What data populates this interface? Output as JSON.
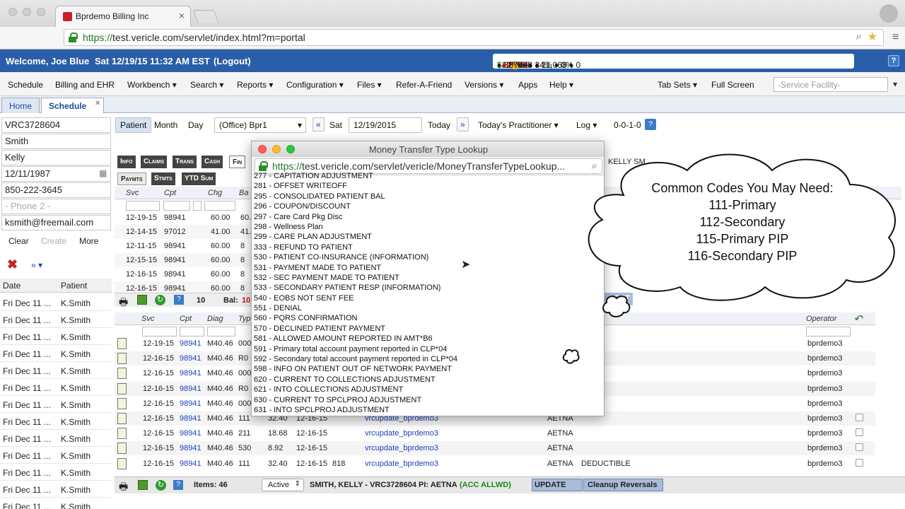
{
  "browser": {
    "tab_title": "Bprdemo Billing Inc",
    "url_secure": "https://",
    "url_rest": "test.vericle.com/servlet/index.html?m=portal"
  },
  "header": {
    "welcome": "Welcome, Joe Blue",
    "datetime": "Sat 12/19/15 11:32 AM EST",
    "logout": "(Logout)",
    "stats": {
      "s1": "$22,739",
      "s2": "♦ 32,399",
      "s3": "449",
      "s4": "♦ 1,030",
      "s5": "♦ 1,496",
      "s6": "27,448 ♦ 11,068 ♦ 0",
      "s7": "85% ♦ 34% ♦ 0%",
      "s8": "0%"
    },
    "help": "?"
  },
  "menu": {
    "items": [
      "Schedule",
      "Billing and EHR",
      "Workbench ▾",
      "Search ▾",
      "Reports ▾",
      "Configuration ▾",
      "Files ▾",
      "Refer-A-Friend",
      "Versions ▾",
      "Apps",
      "Help ▾"
    ],
    "tab_sets": "Tab Sets ▾",
    "full_screen": "Full Screen",
    "service_facility": "-Service Facility-"
  },
  "app_tabs": {
    "home": "Home",
    "schedule": "Schedule"
  },
  "patient": {
    "id": "VRC3728604",
    "last": "Smith",
    "first": "Kelly",
    "dob": "12/11/1987",
    "phone1": "850-222-3645",
    "phone2_placeholder": "- Phone 2 -",
    "email": "ksmith@freemail.com",
    "clear": "Clear",
    "create": "Create",
    "more": "More"
  },
  "list": {
    "date_header": "Date",
    "patient_header": "Patient",
    "rows": [
      {
        "date": "Fri Dec 11 ...",
        "patient": "K.Smith"
      },
      {
        "date": "Fri Dec 11 ...",
        "patient": "K.Smith"
      },
      {
        "date": "Fri Dec 11 ...",
        "patient": "K.Smith"
      },
      {
        "date": "Fri Dec 11 ...",
        "patient": "K.Smith"
      },
      {
        "date": "Fri Dec 11 ...",
        "patient": "K.Smith"
      },
      {
        "date": "Fri Dec 11 ...",
        "patient": "K.Smith"
      },
      {
        "date": "Fri Dec 11 ...",
        "patient": "K.Smith"
      },
      {
        "date": "Fri Dec 11 ...",
        "patient": "K.Smith"
      },
      {
        "date": "Fri Dec 11 ...",
        "patient": "K.Smith"
      },
      {
        "date": "Fri Dec 11 ...",
        "patient": "K.Smith"
      },
      {
        "date": "Fri Dec 11 ...",
        "patient": "K.Smith"
      },
      {
        "date": "Fri Dec 11 ...",
        "patient": "K.Smith"
      },
      {
        "date": "Fri Dec 11 ...",
        "patient": "K.Smith"
      }
    ]
  },
  "toolbar": {
    "patient": "Patient",
    "month": "Month",
    "day": "Day",
    "office": "(Office) Bpr1",
    "sat": "Sat",
    "date": "12/19/2015",
    "today": "Today",
    "practitioner": "Today's Practitioner ▾",
    "log": "Log ▾",
    "counter": "0-0-1-0",
    "patient_name_right": "KELLY SM"
  },
  "detail_tabs": [
    "Info",
    "Claims",
    "Trans",
    "Cash",
    "Fin"
  ],
  "sub_tabs": [
    "Paymts",
    "Stmts",
    "YTD Sum"
  ],
  "upper_grid": {
    "headers": [
      "Svc",
      "Cpt",
      "Chg",
      "Ba"
    ],
    "rows": [
      [
        "12-19-15",
        "98941",
        "60.00",
        "60."
      ],
      [
        "12-14-15",
        "97012",
        "41.00",
        "41."
      ],
      [
        "12-11-15",
        "98941",
        "60.00",
        "8"
      ],
      [
        "12-15-15",
        "98941",
        "60.00",
        "8"
      ],
      [
        "12-16-15",
        "98941",
        "60.00",
        "8"
      ],
      [
        "12-16-15",
        "98941",
        "60.00",
        "8"
      ]
    ],
    "count": "10",
    "bal_label": "Bal:",
    "bal_value": "10"
  },
  "lower_grid": {
    "headers": [
      "Svc",
      "Cpt",
      "Diag",
      "Typ"
    ],
    "operator_header": "Operator",
    "rows": [
      {
        "svc": "12-19-15",
        "cpt": "98941",
        "diag": "M40.46",
        "typ": "000",
        "amt": "",
        "date": "",
        "code": "",
        "link": "",
        "payer": "",
        "note": "",
        "op": "bprdemo3"
      },
      {
        "svc": "12-16-15",
        "cpt": "98941",
        "diag": "M40.46",
        "typ": "R0",
        "amt": "",
        "date": "",
        "code": "",
        "link": "",
        "payer": "",
        "note": "",
        "op": "bprdemo3"
      },
      {
        "svc": "12-16-15",
        "cpt": "98941",
        "diag": "M40.46",
        "typ": "000",
        "amt": "",
        "date": "",
        "code": "",
        "link": "",
        "payer": "",
        "note": "",
        "op": "bprdemo3"
      },
      {
        "svc": "12-16-15",
        "cpt": "98941",
        "diag": "M40.46",
        "typ": "R0",
        "amt": "",
        "date": "",
        "code": "",
        "link": "",
        "payer": "",
        "note": "",
        "op": "bprdemo3"
      },
      {
        "svc": "12-16-15",
        "cpt": "98941",
        "diag": "M40.46",
        "typ": "000",
        "amt": "",
        "date": "",
        "code": "",
        "link": "",
        "payer": "",
        "note": "",
        "op": "bprdemo3"
      },
      {
        "svc": "12-16-15",
        "cpt": "98941",
        "diag": "M40.46",
        "typ": "111",
        "amt": "32.40",
        "date": "12-16-15",
        "code": "",
        "link": "vrcupdate_bprdemo3",
        "payer": "AETNA",
        "note": "",
        "op": "bprdemo3"
      },
      {
        "svc": "12-16-15",
        "cpt": "98941",
        "diag": "M40.46",
        "typ": "211",
        "amt": "18.68",
        "date": "12-16-15",
        "code": "",
        "link": "vrcupdate_bprdemo3",
        "payer": "AETNA",
        "note": "",
        "op": "bprdemo3"
      },
      {
        "svc": "12-16-15",
        "cpt": "98941",
        "diag": "M40.46",
        "typ": "530",
        "amt": "8.92",
        "date": "12-16-15",
        "code": "",
        "link": "vrcupdate_bprdemo3",
        "payer": "AETNA",
        "note": "",
        "op": "bprdemo3"
      },
      {
        "svc": "12-16-15",
        "cpt": "98941",
        "diag": "M40.46",
        "typ": "111",
        "amt": "32.40",
        "date": "12-16-15",
        "code": "818",
        "link": "vrcupdate_bprdemo3",
        "payer": "AETNA",
        "note": "DEDUCTIBLE",
        "op": "bprdemo3"
      }
    ]
  },
  "statusbar": {
    "items": "Items: 46",
    "active": "Active",
    "patient_info": "SMITH, KELLY - VRC3728604 PI: AETNA",
    "acc": "(ACC ALLWD)",
    "update": "UPDATE",
    "cleanup": "Cleanup Reversals"
  },
  "popup": {
    "title": "Money Transfer Type Lookup",
    "url_secure": "https://",
    "url_rest": "test.vericle.com/servlet/vericle/MoneyTransferTypeLookup...",
    "items": [
      "277 - CAPITATION ADJUSTMENT",
      "281 - OFFSET WRITEOFF",
      "295 - CONSOLIDATED PATIENT BAL",
      "296 - COUPON/DISCOUNT",
      "297 - Care Card Pkg Disc",
      "298 - Wellness Plan",
      "299 - CARE PLAN ADJUSTMENT",
      "333 - REFUND TO PATIENT",
      "530 - PATIENT CO-INSURANCE (INFORMATION)",
      "531 - PAYMENT MADE TO PATIENT",
      "532 - SEC PAYMENT MADE TO PATIENT",
      "533 - SECONDARY PATIENT RESP (INFORMATION)",
      "540 - EOBS NOT SENT FEE",
      "551 - DENIAL",
      "560 - PQRS CONFIRMATION",
      "570 - DECLINED PATIENT PAYMENT",
      "581 - ALLOWED AMOUNT REPORTED IN AMT*B6",
      "591 - Primary total account payment reported in CLP*04",
      "592 - Secondary total account payment reported in CLP*04",
      "598 - INFO ON PATIENT OUT OF NETWORK PAYMENT",
      "620 - CURRENT TO COLLECTIONS ADJUSTMENT",
      "621 - INTO COLLECTIONS ADJUSTMENT",
      "630 - CURRENT TO SPCLPROJ ADJUSTMENT",
      "631 - INTO SPCLPROJ ADJUSTMENT"
    ]
  },
  "cloud": {
    "line1": "Common Codes You May Need:",
    "line2": "111-Primary",
    "line3": "112-Secondary",
    "line4": "115-Primary PIP",
    "line5": "116-Secondary PIP"
  },
  "colors": {
    "header_blue": "#2a5ea8",
    "link_blue": "#1d3fb8",
    "green": "#198a19",
    "red": "#c61a1a"
  }
}
